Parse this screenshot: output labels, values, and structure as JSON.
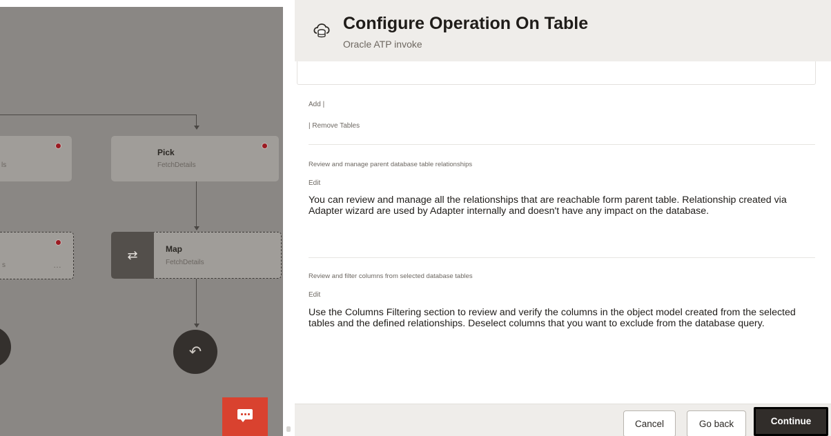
{
  "canvas": {
    "nodes": [
      {
        "id": "left-top",
        "subtitle": "ls"
      },
      {
        "id": "pick",
        "title": "Pick",
        "subtitle": "FetchDetails"
      },
      {
        "id": "left-mid",
        "subtitle": "s",
        "more": "…"
      },
      {
        "id": "map",
        "title": "Map",
        "subtitle": "FetchDetails"
      }
    ],
    "map_icon": "⇄",
    "return_icon": "↶",
    "colors": {
      "error": "#9b1b22",
      "chat": "#d9422f"
    }
  },
  "panel": {
    "title": "Configure Operation On Table",
    "subtitle": "Oracle ATP invoke",
    "add_link": "Add |",
    "remove_link": "| Remove Tables",
    "sections": [
      {
        "label": "Review and manage parent database table relationships",
        "edit": "Edit",
        "text": "You can review and manage all the relationships that are reachable form parent table. Relationship created via Adapter wizard are used by Adapter internally and doesn't have any impact on the database."
      },
      {
        "label": "Review and filter columns from selected database tables",
        "edit": "Edit",
        "text": "Use the Columns Filtering section to review and verify the columns in the object model created from the selected tables and the defined relationships. Deselect columns that you want to exclude from the database query."
      }
    ]
  },
  "footer": {
    "cancel": "Cancel",
    "go_back": "Go back",
    "continue": "Continue"
  }
}
